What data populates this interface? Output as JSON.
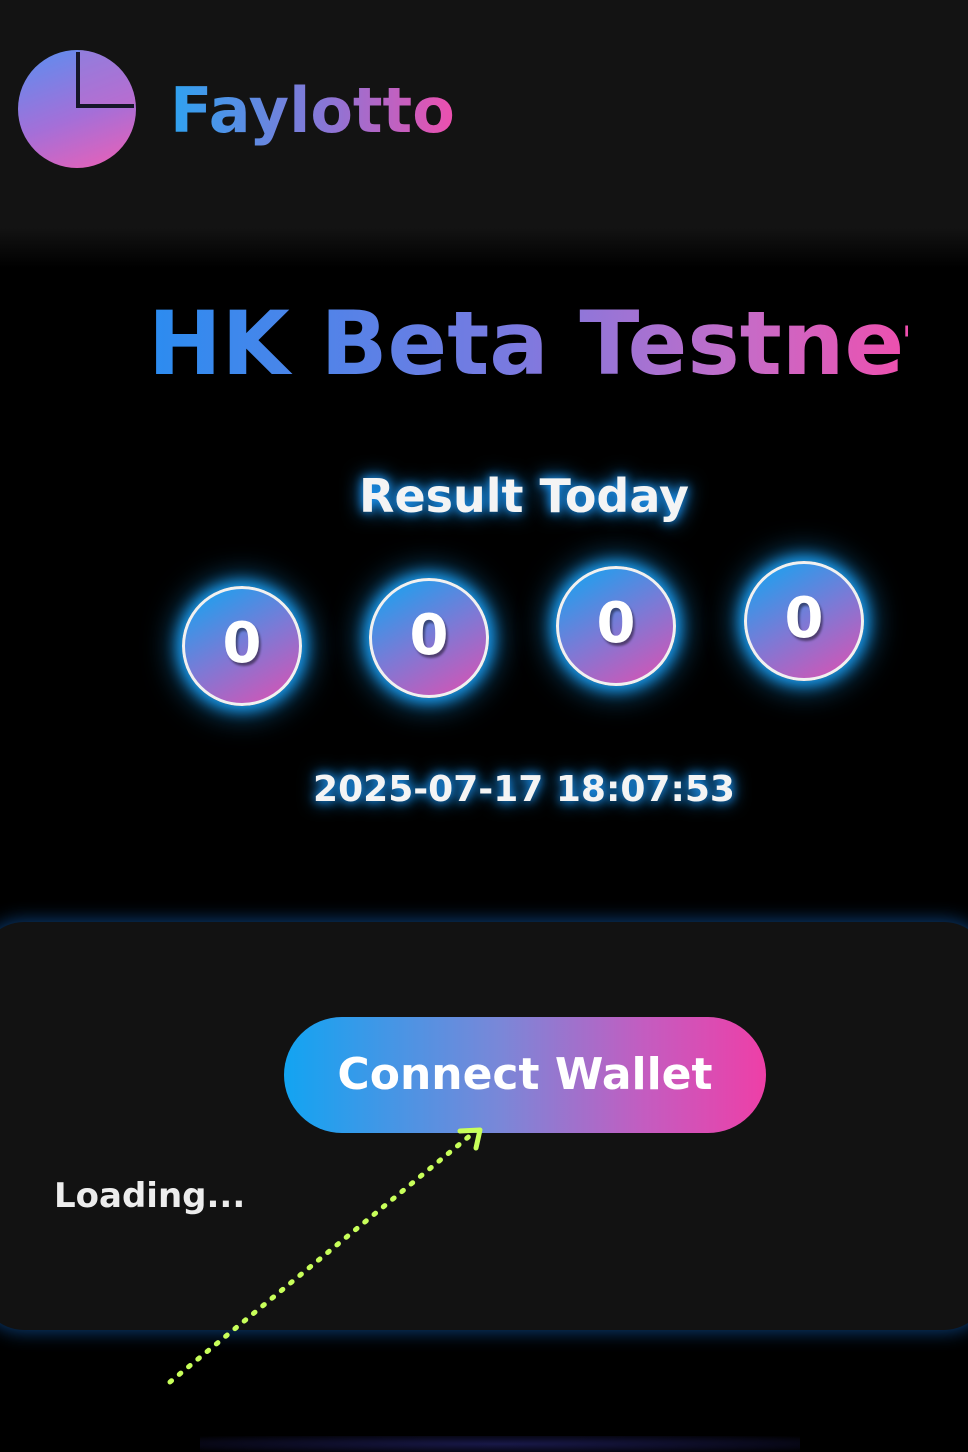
{
  "app": {
    "brand_name": "Faylotto",
    "logo_icon": "pie-chart-logo-icon"
  },
  "hero": {
    "title": "HK Beta Testnet"
  },
  "result": {
    "label": "Result Today",
    "numbers": [
      "0",
      "0",
      "0",
      "0"
    ],
    "timestamp": "2025-07-17 18:07:53"
  },
  "wallet": {
    "connect_label": "Connect Wallet",
    "status_text": "Loading..."
  },
  "colors": {
    "background": "#000000",
    "header_bg": "#131313",
    "panel_bg": "#121212",
    "gradient_start": "#12a4f2",
    "gradient_end": "#ee3fa7",
    "glow": "#1e9cff",
    "annotation_arrow": "#c8ff5a"
  }
}
